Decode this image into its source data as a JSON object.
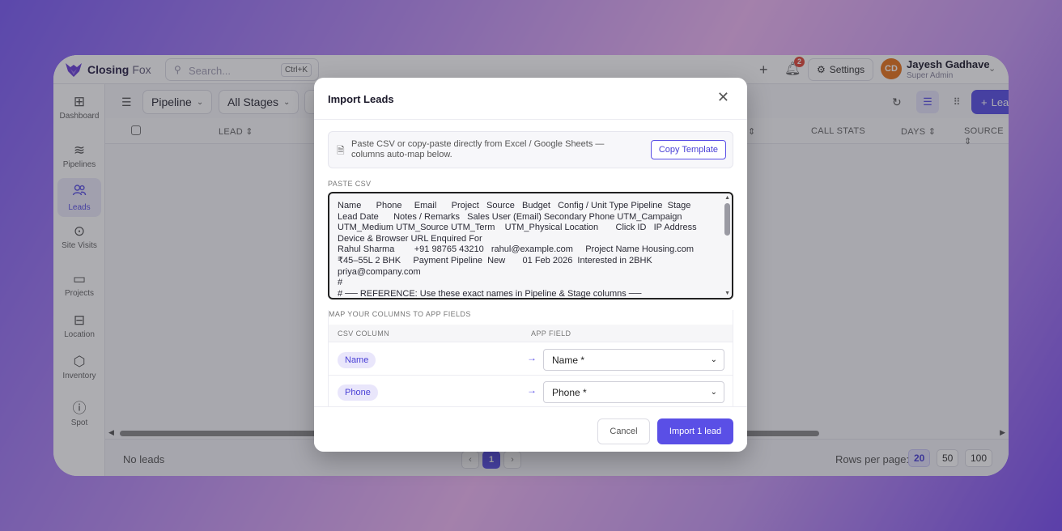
{
  "app": {
    "brand_first": "Closing",
    "brand_second": "Fox",
    "search_placeholder": "Search...",
    "search_shortcut": "Ctrl+K",
    "notification_count": "2",
    "settings_label": "Settings",
    "user": {
      "initials": "CD",
      "name": "Jayesh Gadhave",
      "role": "Super Admin"
    }
  },
  "sidebar": {
    "items": [
      {
        "label": "Dashboard",
        "icon": "dashboard-icon",
        "glyph": "⊞"
      },
      {
        "label": "Pipelines",
        "icon": "layers-icon",
        "glyph": "≋"
      },
      {
        "label": "Leads",
        "icon": "users-icon",
        "glyph": "👥"
      },
      {
        "label": "Site Visits",
        "icon": "map-pin-icon",
        "glyph": "⊙"
      },
      {
        "label": "Projects",
        "icon": "folder-icon",
        "glyph": "▭"
      },
      {
        "label": "Location",
        "icon": "map-icon",
        "glyph": "⊟"
      },
      {
        "label": "Inventory",
        "icon": "box-icon",
        "glyph": "⬡"
      },
      {
        "label": "Spot",
        "icon": "alert-circle-icon",
        "glyph": "ⓘ"
      }
    ],
    "active": "Leads"
  },
  "toolbar": {
    "pipeline_label": "Pipeline",
    "stages_label": "All Stages",
    "add_lead_label": "Lead"
  },
  "table": {
    "headers": {
      "lead": "LEAD ⇕",
      "call_stats": "CALL STATS",
      "days": "DAYS ⇕",
      "source": "SOURCE ⇕",
      "partial": "⇕"
    }
  },
  "footer": {
    "empty_text": "No leads",
    "current_page": "1",
    "rows_per_page_label": "Rows per page:",
    "rows_options": [
      "20",
      "50",
      "100"
    ],
    "rows_selected": "20"
  },
  "modal": {
    "title": "Import Leads",
    "info_text": "Paste CSV or copy-paste directly from Excel / Google Sheets — columns auto-map below.",
    "copy_template_label": "Copy Template",
    "paste_label": "PASTE CSV",
    "csv_text": "Name      Phone     Email      Project   Source   Budget   Config / Unit Type Pipeline  Stage      Lead Date      Notes / Remarks   Sales User (Email) Secondary Phone UTM_Campaign    UTM_Medium UTM_Source UTM_Term    UTM_Physical Location       Click ID   IP Address     Device & Browser URL Enquired For\nRahul Sharma        +91 98765 43210   rahul@example.com     Project Name Housing.com  ₹45–55L 2 BHK     Payment Pipeline  New       01 Feb 2026  Interested in 2BHK       priya@company.com\n#\n# ── REFERENCE: Use these exact names in Pipeline & Stage columns ──\n# Pipeline: Payment Pipeline",
    "map_title": "MAP YOUR COLUMNS TO APP FIELDS",
    "map_col_csv": "CSV COLUMN",
    "map_col_app": "APP FIELD",
    "mappings": [
      {
        "csv": "Name",
        "field": "Name *"
      },
      {
        "csv": "Phone",
        "field": "Phone *"
      }
    ],
    "cancel_label": "Cancel",
    "import_label": "Import 1 lead"
  },
  "colors": {
    "accent": "#5a4fe6",
    "badge": "#e24a3b",
    "avatar": "#e8741c"
  }
}
